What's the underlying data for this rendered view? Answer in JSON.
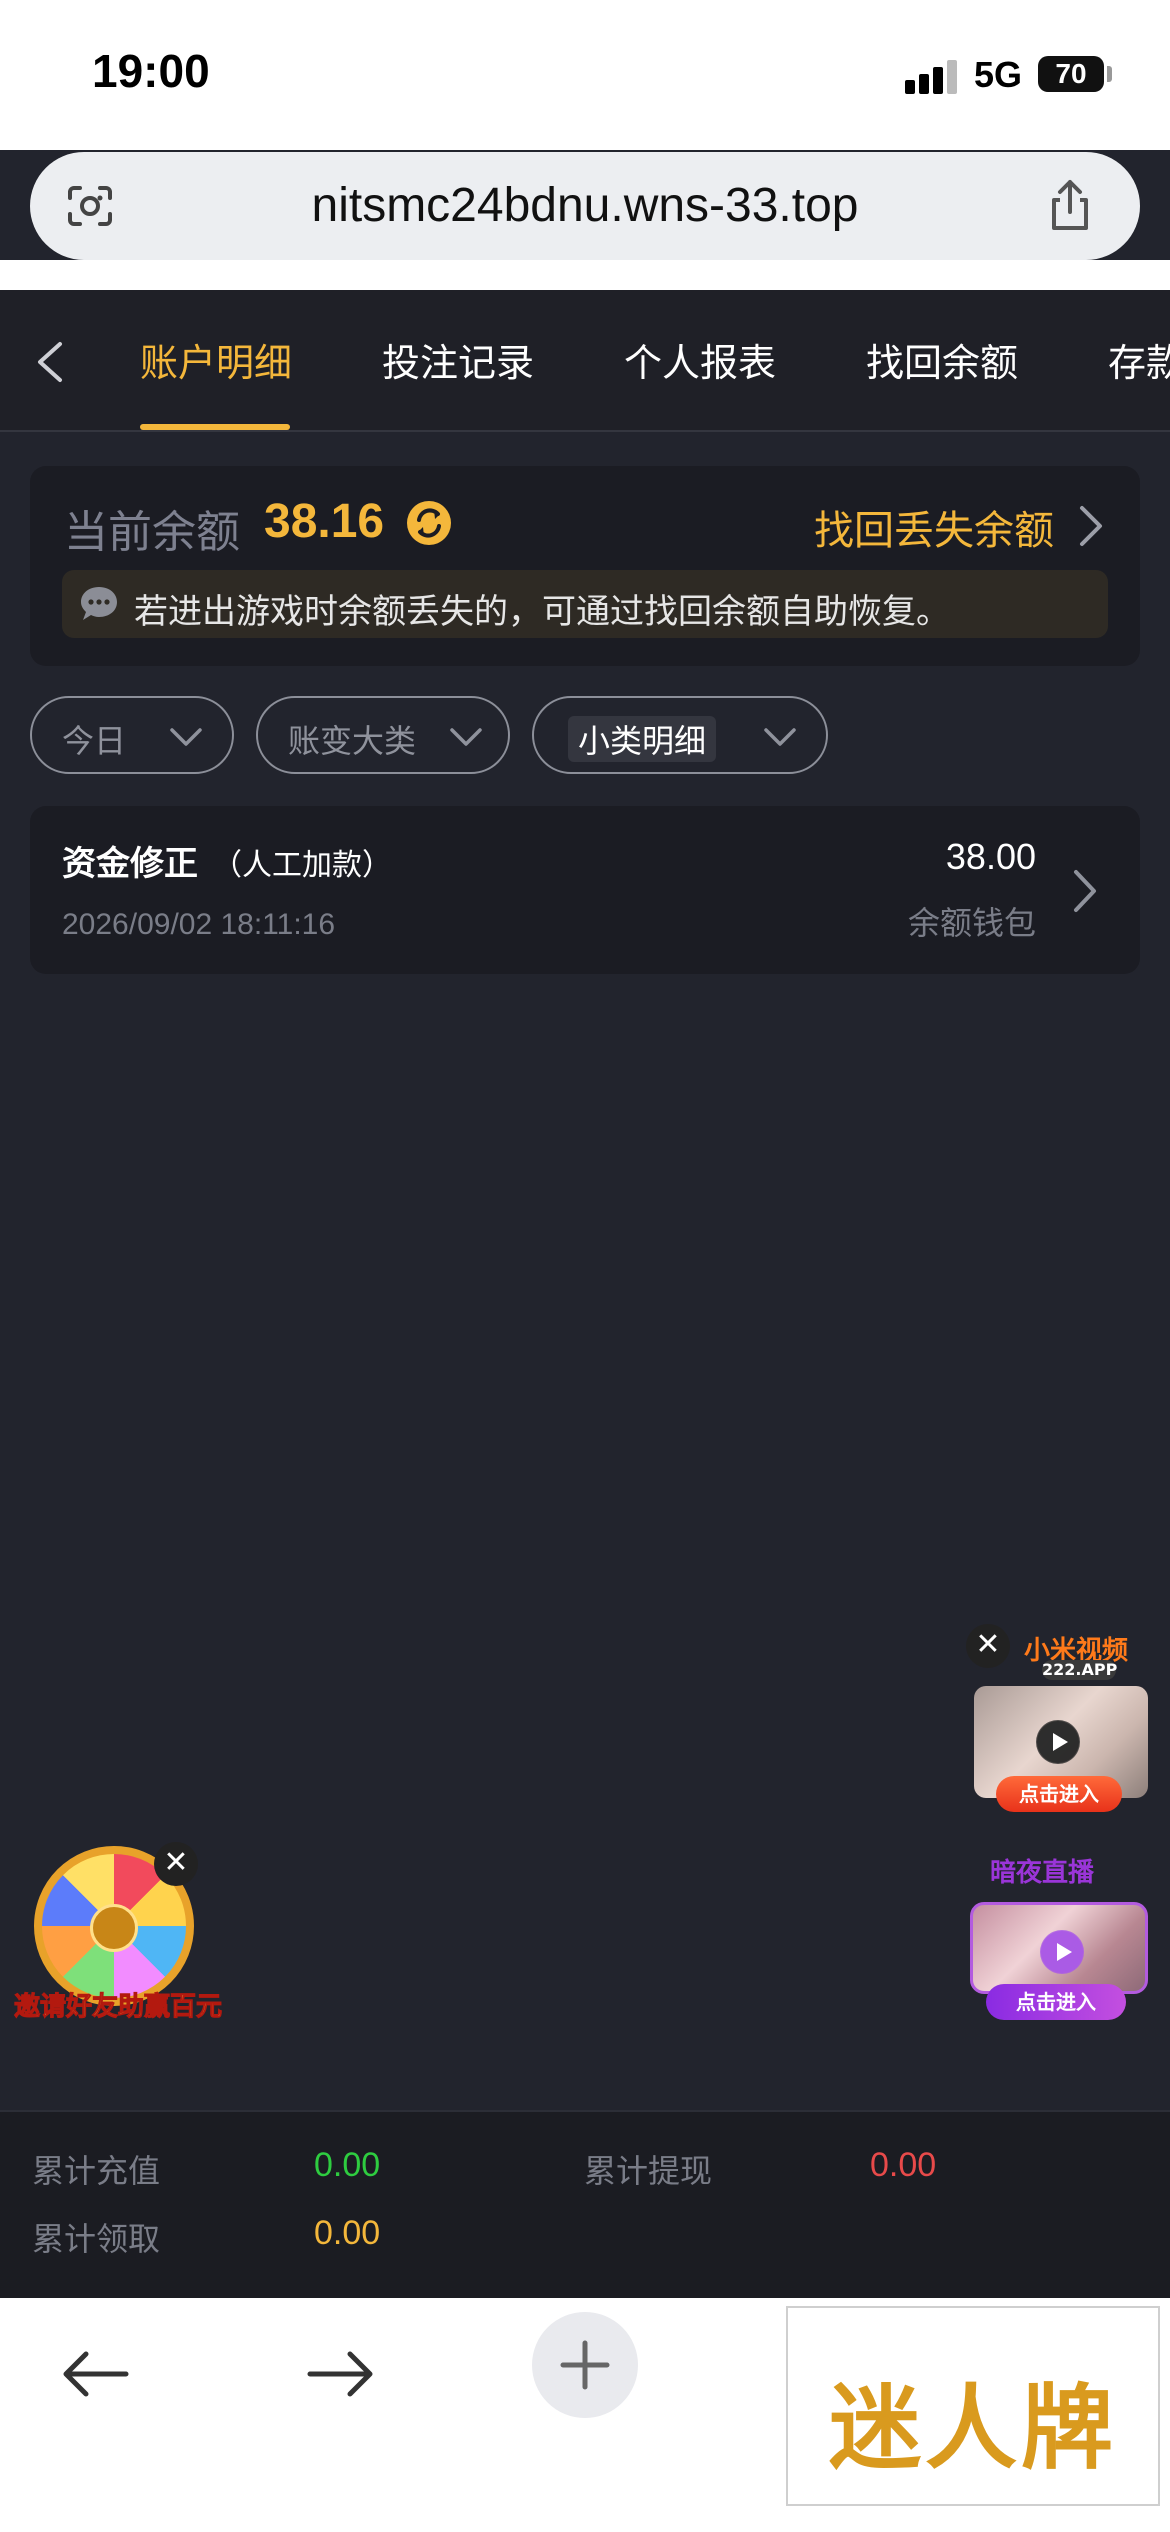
{
  "status_bar": {
    "time": "19:00",
    "network": "5G",
    "battery": "70"
  },
  "browser": {
    "url": "nitsmc24bdnu.wns-33.top"
  },
  "tabs": [
    {
      "label": "账户明细",
      "active": true
    },
    {
      "label": "投注记录",
      "active": false
    },
    {
      "label": "个人报表",
      "active": false
    },
    {
      "label": "找回余额",
      "active": false
    },
    {
      "label": "存款",
      "active": false
    }
  ],
  "balance": {
    "label": "当前余额",
    "value": "38.16",
    "recover_label": "找回丢失余额",
    "notice": "若进出游戏时余额丢失的，可通过找回余额自助恢复。"
  },
  "filters": [
    {
      "label": "今日"
    },
    {
      "label": "账变大类"
    },
    {
      "label": "小类明细"
    }
  ],
  "records": [
    {
      "title": "资金修正",
      "subtitle": "（人工加款）",
      "datetime": "2026/09/02 18:11:16",
      "amount": "38.00",
      "wallet": "余额钱包"
    }
  ],
  "ads": {
    "right_top": {
      "logo": "小米视频",
      "sub": "222.APP",
      "button": "点击进入"
    },
    "right_bottom": {
      "logo": "暗夜直播",
      "button": "点击进入"
    },
    "left": {
      "text": "邀请好友助赢百元"
    }
  },
  "summary": {
    "total_deposit_label": "累计充值",
    "total_deposit": "0.00",
    "total_withdraw_label": "累计提现",
    "total_withdraw": "0.00",
    "total_claim_label": "累计领取",
    "total_claim": "0.00"
  },
  "bottom_bar": {
    "brand": "迷人牌"
  },
  "colors": {
    "accent": "#f4b73b",
    "background": "#22242d",
    "card": "#1b1c23",
    "deposit_green": "#2ecc40",
    "withdraw_red": "#e84a4a"
  }
}
